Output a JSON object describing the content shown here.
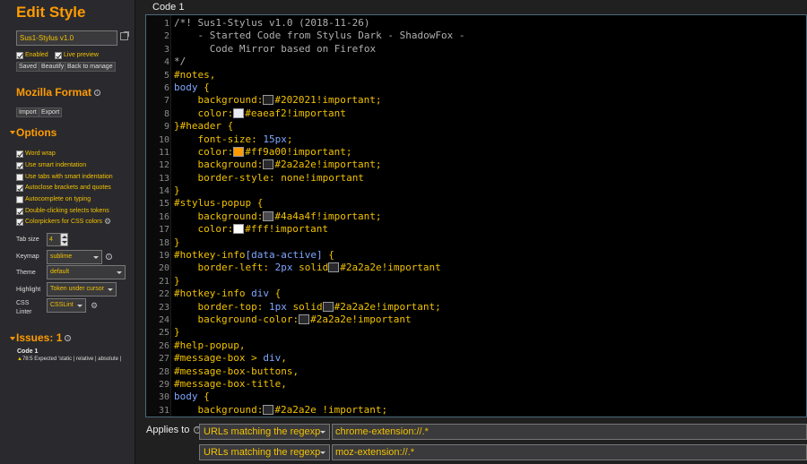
{
  "sidebar": {
    "title": "Edit Style",
    "name_value": "Sus1-Stylus v1.0",
    "enabled_label": "Enabled",
    "live_preview_label": "Live preview",
    "buttons": {
      "saved": "Saved",
      "beautify": "Beautify",
      "back": "Back to manage"
    },
    "mozilla_format": {
      "title": "Mozilla Format",
      "import": "Import",
      "export": "Export"
    },
    "options": {
      "title": "Options",
      "items": [
        {
          "label": "Word wrap",
          "checked": true
        },
        {
          "label": "Use smart indentation",
          "checked": true
        },
        {
          "label": "Use tabs with smart indentation",
          "checked": false
        },
        {
          "label": "Autoclose brackets and quotes",
          "checked": true
        },
        {
          "label": "Autocomplete on typing",
          "checked": false
        },
        {
          "label": "Double-clicking selects tokens",
          "checked": true
        },
        {
          "label": "Colorpickers for CSS colors",
          "checked": true
        }
      ],
      "tab_size_label": "Tab size",
      "tab_size_value": "4",
      "keymap_label": "Keymap",
      "keymap_value": "sublime",
      "theme_label": "Theme",
      "theme_value": "default",
      "highlight_label": "Highlight",
      "highlight_value": "Token under cursor",
      "linter_label": "CSS Linter",
      "linter_value": "CSSLint"
    },
    "issues": {
      "title": "Issues: 1",
      "section": "Code 1",
      "message": "78:5 Expected 'static | relative | absolute |"
    }
  },
  "editor": {
    "label": "Code 1",
    "lines": [
      [
        [
          "c-cm",
          "/*! Sus1-Stylus v1.0 (2018-11-26)"
        ]
      ],
      [
        [
          "c-cm",
          "    - Started Code from Stylus Dark - ShadowFox -"
        ]
      ],
      [
        [
          "c-cm",
          "      Code Mirror based on Firefox"
        ]
      ],
      [
        [
          "c-cm",
          "*/"
        ]
      ],
      [
        [
          "c-sel",
          "#notes,"
        ]
      ],
      [
        [
          "c-kw",
          "body"
        ],
        [
          "c-pun",
          " {"
        ]
      ],
      [
        [
          "c-prop",
          "    background:"
        ],
        [
          "sw",
          "#202021"
        ],
        [
          "c-val",
          "#202021!important;"
        ]
      ],
      [
        [
          "c-prop",
          "    color:"
        ],
        [
          "sw",
          "#eaeaf2"
        ],
        [
          "c-val",
          "#eaeaf2!important"
        ]
      ],
      [
        [
          "c-pun",
          "}"
        ],
        [
          "c-sel",
          "#header"
        ],
        [
          "c-pun",
          " {"
        ]
      ],
      [
        [
          "c-prop",
          "    font-size: "
        ],
        [
          "c-num",
          "15px"
        ],
        [
          "c-pun",
          ";"
        ]
      ],
      [
        [
          "c-prop",
          "    color:"
        ],
        [
          "sw",
          "#ff9a00"
        ],
        [
          "c-val",
          "#ff9a00!important;"
        ]
      ],
      [
        [
          "c-prop",
          "    background:"
        ],
        [
          "sw",
          "#2a2a2e"
        ],
        [
          "c-val",
          "#2a2a2e!important;"
        ]
      ],
      [
        [
          "c-prop",
          "    border-style: "
        ],
        [
          "c-val",
          "none!important"
        ]
      ],
      [
        [
          "c-pun",
          "}"
        ]
      ],
      [
        [
          "c-sel",
          "#stylus-popup"
        ],
        [
          "c-pun",
          " {"
        ]
      ],
      [
        [
          "c-prop",
          "    background:"
        ],
        [
          "sw",
          "#4a4a4f"
        ],
        [
          "c-val",
          "#4a4a4f!important;"
        ]
      ],
      [
        [
          "c-prop",
          "    color:"
        ],
        [
          "sw",
          "#fff"
        ],
        [
          "c-val",
          "#fff!important"
        ]
      ],
      [
        [
          "c-pun",
          "}"
        ]
      ],
      [
        [
          "c-sel",
          "#hotkey-info"
        ],
        [
          "c-kw",
          "[data-active]"
        ],
        [
          "c-pun",
          " {"
        ]
      ],
      [
        [
          "c-prop",
          "    border-left: "
        ],
        [
          "c-num",
          "2px"
        ],
        [
          "c-val",
          " solid"
        ],
        [
          "sw",
          "#2a2a2e"
        ],
        [
          "c-val",
          "#2a2a2e!important"
        ]
      ],
      [
        [
          "c-pun",
          "}"
        ]
      ],
      [
        [
          "c-sel",
          "#hotkey-info "
        ],
        [
          "c-kw",
          "div"
        ],
        [
          "c-pun",
          " {"
        ]
      ],
      [
        [
          "c-prop",
          "    border-top: "
        ],
        [
          "c-num",
          "1px"
        ],
        [
          "c-val",
          " solid"
        ],
        [
          "sw",
          "#2a2a2e"
        ],
        [
          "c-val",
          "#2a2a2e!important;"
        ]
      ],
      [
        [
          "c-prop",
          "    background-color:"
        ],
        [
          "sw",
          "#2a2a2e"
        ],
        [
          "c-val",
          "#2a2a2e!important"
        ]
      ],
      [
        [
          "c-pun",
          "}"
        ]
      ],
      [
        [
          "c-sel",
          "#help-popup,"
        ]
      ],
      [
        [
          "c-sel",
          "#message-box > "
        ],
        [
          "c-kw",
          "div"
        ],
        [
          "c-pun",
          ","
        ]
      ],
      [
        [
          "c-sel",
          "#message-box-buttons,"
        ]
      ],
      [
        [
          "c-sel",
          "#message-box-title,"
        ]
      ],
      [
        [
          "c-kw",
          "body"
        ],
        [
          "c-pun",
          " {"
        ]
      ],
      [
        [
          "c-prop",
          "    background:"
        ],
        [
          "sw",
          "#2a2a2e"
        ],
        [
          "c-val",
          "#2a2a2e !important;"
        ]
      ]
    ]
  },
  "applies": {
    "label": "Applies to",
    "rows": [
      {
        "type": "URLs matching the regexp",
        "value": "chrome-extension://.*"
      },
      {
        "type": "URLs matching the regexp",
        "value": "moz-extension://.*"
      }
    ]
  }
}
